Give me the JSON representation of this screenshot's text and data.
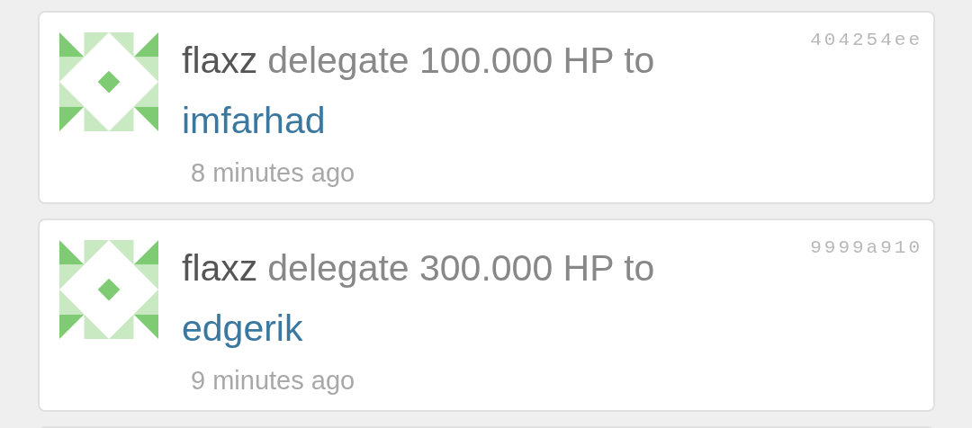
{
  "feed": [
    {
      "actor": "flaxz",
      "action": "delegate 100.000 HP to",
      "target": "imfarhad",
      "time": "8 minutes ago",
      "hash": "404254ee"
    },
    {
      "actor": "flaxz",
      "action": "delegate 300.000 HP to",
      "target": "edgerik",
      "time": "9 minutes ago",
      "hash": "9999a910"
    }
  ]
}
